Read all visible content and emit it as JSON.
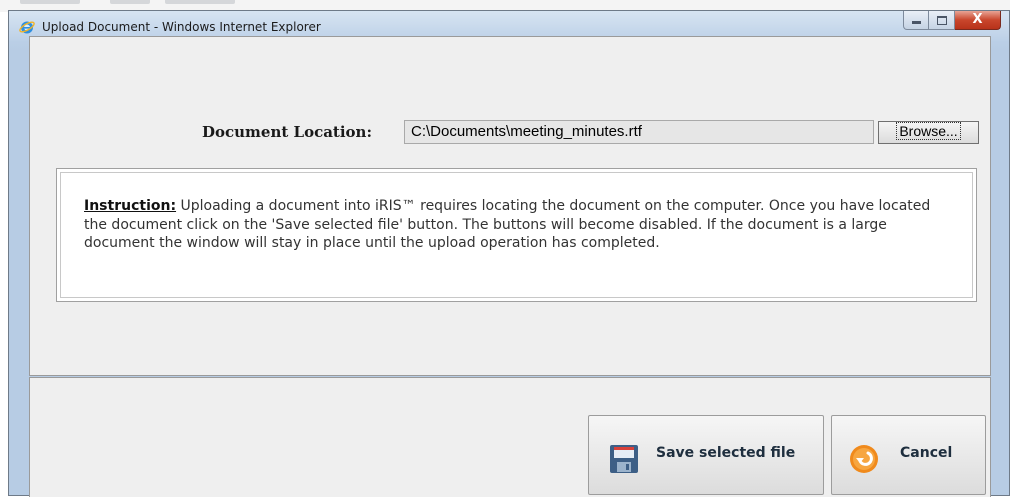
{
  "window": {
    "title": "Upload Document - Windows Internet Explorer",
    "close_glyph": "X"
  },
  "form": {
    "location_label": "Document Location:",
    "location_value": "C:\\Documents\\meeting_minutes.rtf",
    "browse_label": "Browse..."
  },
  "instruction": {
    "heading": "Instruction:",
    "body": "Uploading a document into iRIS™ requires locating the document on the computer. Once you have located the document click on the 'Save selected file' button. The buttons will become disabled. If the document is a large document the window will stay in place until the upload operation has completed."
  },
  "actions": {
    "save_label": "Save selected file",
    "cancel_label": "Cancel"
  },
  "icons": {
    "browser": "internet-explorer-icon",
    "save": "floppy-disk-icon",
    "cancel": "undo-arrow-icon"
  }
}
